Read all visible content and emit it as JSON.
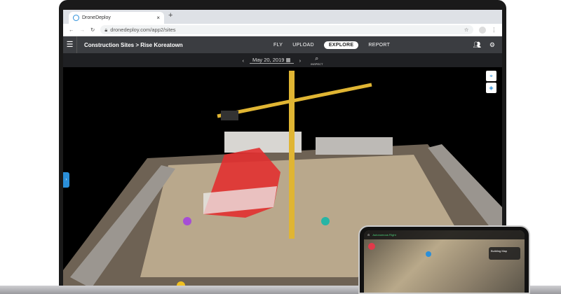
{
  "browser": {
    "tab_title": "DroneDeploy",
    "url": "dronedeploy.com/app2/sites"
  },
  "app": {
    "breadcrumb": "Construction Sites > Rise Koreatown",
    "nav": [
      "FLY",
      "UPLOAD",
      "EXPLORE",
      "REPORT"
    ],
    "active_nav": "EXPLORE",
    "date": "May 20, 2019",
    "inspect_label": "INSPECT"
  },
  "phone": {
    "flight_label": "Autonomous Flight",
    "card_title": "Building Map"
  },
  "colors": {
    "accent": "#2b8fd9",
    "appbar": "#3b3d41"
  }
}
